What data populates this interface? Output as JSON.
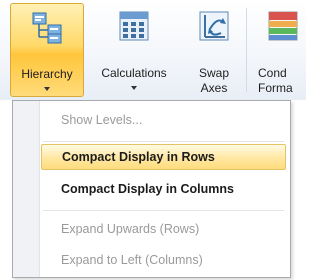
{
  "ribbon": {
    "buttons": [
      {
        "name": "hierarchy",
        "label": "Hierarchy",
        "icon": "hierarchy-icon",
        "has_dropdown": true,
        "active": true
      },
      {
        "name": "calculations",
        "label": "Calculations",
        "icon": "calculator-icon",
        "has_dropdown": true,
        "active": false
      },
      {
        "name": "swap-axes",
        "label_line1": "Swap",
        "label_line2": "Axes",
        "icon": "swap-axes-icon",
        "has_dropdown": false,
        "active": false
      },
      {
        "name": "conditional-formatting",
        "label_line1": "Cond",
        "label_line2": "Forma",
        "icon": "conditional-formatting-icon",
        "has_dropdown": false,
        "active": false
      }
    ]
  },
  "menu": {
    "items": [
      {
        "label": "Show Levels...",
        "enabled": false,
        "highlighted": false
      },
      {
        "label": "Compact Display in Rows",
        "enabled": true,
        "highlighted": true
      },
      {
        "label": "Compact Display in Columns",
        "enabled": true,
        "highlighted": false
      },
      {
        "label": "Expand Upwards (Rows)",
        "enabled": false,
        "highlighted": false
      },
      {
        "label": "Expand to Left (Columns)",
        "enabled": false,
        "highlighted": false
      }
    ]
  },
  "colors": {
    "active_button_top": "#fff1b5",
    "active_button_bottom": "#ffc63c",
    "menu_highlight": "#ffe9a8",
    "disabled_text": "#9a9a9a"
  }
}
